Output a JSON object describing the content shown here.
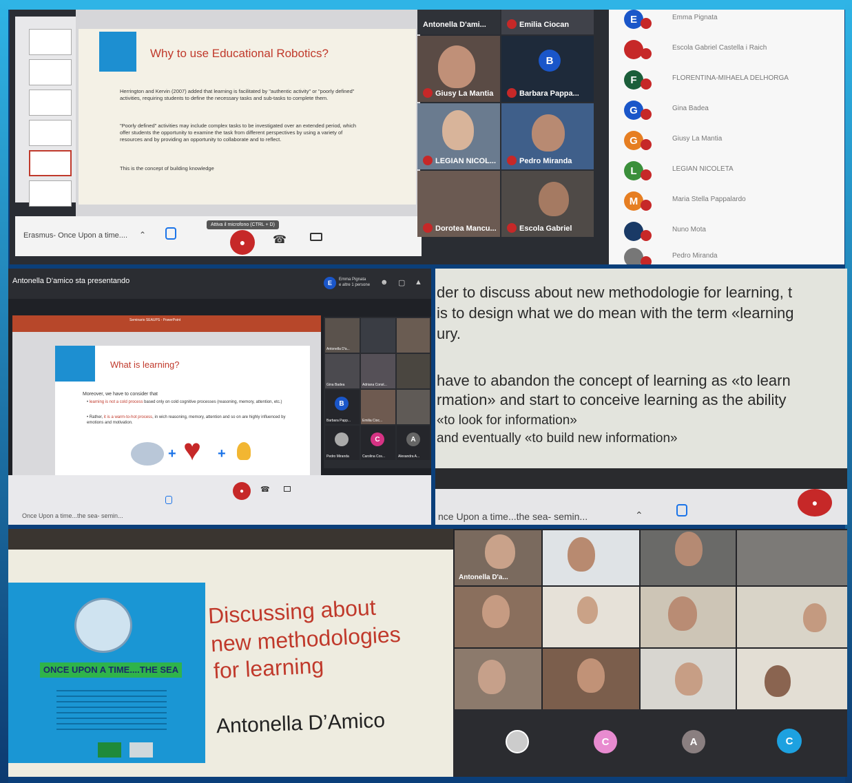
{
  "panel1": {
    "slide_title": "Why to use Educational Robotics?",
    "slide_para1": "Herrington and Kervin (2007) added that learning is facilitated by \"authentic activity\" or \"poorly defined\" activities, requiring students to define the necessary tasks and sub-tasks to complete them.",
    "slide_para2": "\"Poorly defined\" activities may include complex tasks to be investigated over an extended period, which offer students the opportunity to examine the task from different perspectives by using a variety of resources and by providing an opportunity to collaborate and to reflect.",
    "slide_para3": "This is the concept of building knowledge",
    "tooltip": "Attiva il microfono (CTRL + D)",
    "meeting_name": "Erasmus- Once Upon a time....",
    "tiles": [
      {
        "name": "Antonella D'ami..."
      },
      {
        "name": "Emilia Ciocan"
      },
      {
        "name": "Giusy La Mantia"
      },
      {
        "name": "Barbara Pappa..."
      },
      {
        "name": "LEGIAN NICOL..."
      },
      {
        "name": "Pedro Miranda"
      },
      {
        "name": "Dorotea Mancu..."
      },
      {
        "name": "Escola Gabriel"
      }
    ],
    "barbara_initial": "B",
    "participants": [
      {
        "initial": "E",
        "name": "Emma Pignata",
        "color": "#1a56c9"
      },
      {
        "initial": "",
        "name": "Escola Gabriel Castella i Raich",
        "color": "#c62828"
      },
      {
        "initial": "F",
        "name": "FLORENTINA-MIHAELA DELHORGA",
        "color": "#1b5e3a"
      },
      {
        "initial": "G",
        "name": "Gina Badea",
        "color": "#1a56c9"
      },
      {
        "initial": "G",
        "name": "Giusy La Mantia",
        "color": "#e67e22"
      },
      {
        "initial": "L",
        "name": "LEGIAN NICOLETA",
        "color": "#3b8f3b"
      },
      {
        "initial": "M",
        "name": "Maria Stella Pappalardo",
        "color": "#e67e22"
      },
      {
        "initial": "",
        "name": "Nuno Mota",
        "color": "#1a3a66"
      },
      {
        "initial": "",
        "name": "Pedro Miranda",
        "color": "#777777"
      }
    ]
  },
  "panel2": {
    "presenting": "Antonella D'amico sta presentando",
    "top_right_name": "Emma Pignata",
    "top_right_sub": "e altre 1 persone",
    "ppt_title": "Seminario SEAUPS - PowerPoint",
    "slide_title": "What is learning?",
    "slide_intro": "Moreover, we have to consider that",
    "bullet1_a": "learning is not a cold process",
    "bullet1_b": " based only on cold cognitive processes (reasoning, memory, attention, etc.)",
    "bullet2_a": "Rather, ",
    "bullet2_b": "it is a warm-to-hot process",
    "bullet2_c": ", in wich reasoning, memory, attention and so on are highly influenced by emotions and motivation.",
    "meeting_name": "Once Upon a time...the sea- semin...",
    "grid_names": [
      "Antonella D'a...",
      "Gina Badea",
      "Adriana Const...",
      "Barbara Papp...",
      "Emilia Cioc...",
      "Pedro Miranda",
      "Carolina Cos...",
      "Alexandra A..."
    ],
    "initials": [
      "B",
      "C",
      "A"
    ]
  },
  "panel3": {
    "lines": [
      "der to discuss about new methodologie for learning, t",
      "is to design what we do mean with the term «learning",
      "ury.",
      "have to abandon the concept of learning as «to learn",
      "rmation» and start to conceive learning as the ability",
      "«to look for information»",
      "and eventually «to build new information»"
    ],
    "meeting_name": "nce Upon a time...the sea- semin..."
  },
  "panel4": {
    "title_line1": "Discussing about",
    "title_line2": "new methodologies",
    "title_line3": "for learning",
    "author": "Antonella D’Amico",
    "logo_banner": "ONCE UPON A TIME....THE SEA",
    "speaker": "Antonella D'a...",
    "initials": [
      "C",
      "A",
      "C"
    ],
    "initial_colors": [
      "#e88bd0",
      "#8a7f80",
      "#1da1e0"
    ]
  }
}
